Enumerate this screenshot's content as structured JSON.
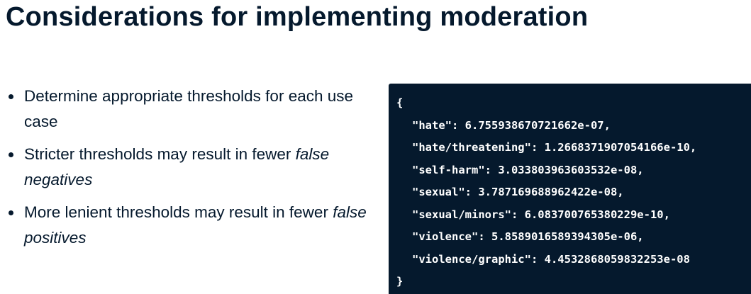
{
  "slide": {
    "title": "Considerations for implementing moderation"
  },
  "bullets": [
    {
      "text": "Determine appropriate thresholds for each use case",
      "italic": ""
    },
    {
      "text": "Stricter thresholds may result in fewer ",
      "italic": "false negatives"
    },
    {
      "text": "More lenient thresholds may result in fewer ",
      "italic": "false positives"
    }
  ],
  "code": {
    "open_brace": "{",
    "lines": [
      "\"hate\": 6.755938670721662e-07,",
      "\"hate/threatening\": 1.2668371907054166e-10,",
      "\"self-harm\": 3.033803963603532e-08,",
      "\"sexual\": 3.787169688962422e-08,",
      "\"sexual/minors\": 6.083700765380229e-10,",
      "\"violence\": 5.8589016589394305e-06,",
      "\"violence/graphic\": 4.4532868059832253e-08"
    ],
    "close_brace": "}"
  },
  "colors": {
    "text": "#05192d",
    "code_background": "#05192d",
    "code_text": "#ffffff"
  }
}
